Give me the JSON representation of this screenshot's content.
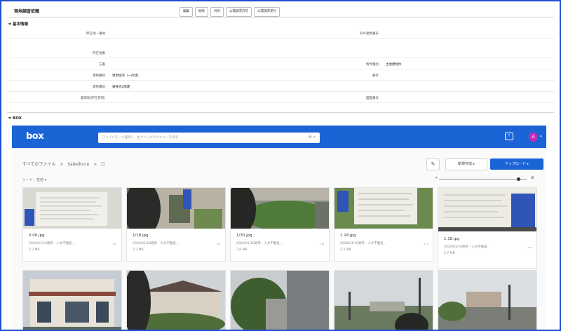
{
  "record": {
    "title": "現地調査依頼",
    "actions": [
      "編集",
      "削除",
      "共有",
      "公開請求許可",
      "公開請求受付"
    ]
  },
  "basic_section": {
    "heading": "基本情報",
    "fields": [
      {
        "label": "所在地・番地",
        "value": "",
        "label2": "BOX連携番号",
        "value2": ""
      },
      {
        "label": "所在地番",
        "value": "",
        "label2": "",
        "value2": ""
      },
      {
        "label": "方書",
        "value": "",
        "label2": "物件種別",
        "value2": "土地建物件"
      },
      {
        "label": "建物種別",
        "value": "専用住宅（一戸建）",
        "label2": "備考",
        "value2": ""
      },
      {
        "label": "建物構造",
        "value": "鉄骨造2階建",
        "label2": "",
        "value2": ""
      },
      {
        "label": "最寄駅(所在参照)",
        "value": "",
        "label2": "図面番号",
        "value2": ""
      }
    ]
  },
  "box_section": {
    "heading": "BOX"
  },
  "box": {
    "logo": "box",
    "search_placeholder": "ファイルを一つ選択し、右クリックでメニューを表示",
    "help_icon": "?",
    "avatar_initial": "A",
    "breadcrumb": [
      "すべてのファイル",
      ">",
      "Salesforce",
      ">",
      "☐"
    ],
    "new_button": "新規作成 ▸",
    "upload_button": "アップロード ▸",
    "sort_label": "ソート：名前 ▾",
    "zoom_fraction": 0.9,
    "files": [
      {
        "name": "0.00.jpg",
        "meta": "2020/01/18更新 - 人文不動産...",
        "size": "2.2 MB"
      },
      {
        "name": "1/18.jpg",
        "meta": "2020/01/18更新 - 人文不動産...",
        "size": "2.3 MB"
      },
      {
        "name": "1/30.jpg",
        "meta": "2020/01/18更新 - 人文不動産...",
        "size": "3.8 MB"
      },
      {
        "name": "1.18.jpg",
        "meta": "2020/01/18更新 - 人文不動産...",
        "size": "2.3 MB"
      },
      {
        "name": "1.18.jpg",
        "meta": "2020/01/18更新 - 人文不動産...",
        "size": "2.7 MB"
      }
    ]
  },
  "colors": {
    "frame_border": "#1f4fd1",
    "box_blue": "#1a64d6",
    "avatar": "#c22bb6"
  }
}
